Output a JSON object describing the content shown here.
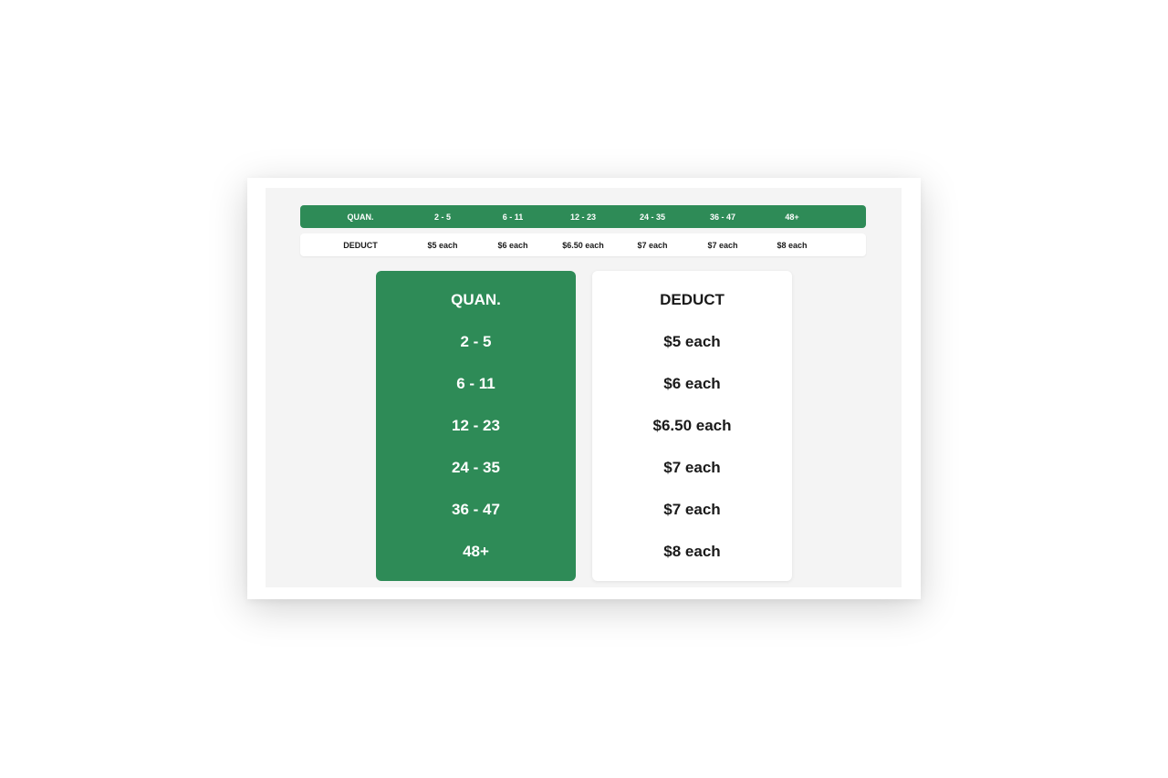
{
  "table": {
    "quantity_header": "QUAN.",
    "deduct_header": "DEDUCT",
    "quantities": [
      "2 - 5",
      "6 - 11",
      "12 - 23",
      "24 - 35",
      "36 - 47",
      "48+"
    ],
    "deductions": [
      "$5 each",
      "$6 each",
      "$6.50 each",
      "$7 each",
      "$7 each",
      "$8 each"
    ]
  },
  "colors": {
    "accent_green": "#2e8b57",
    "panel_background": "#f4f4f4"
  }
}
